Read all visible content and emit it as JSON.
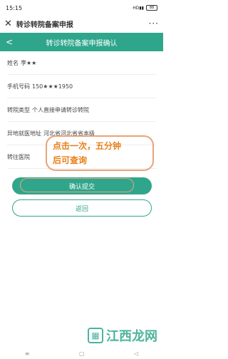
{
  "status_bar": {
    "time": "15:15",
    "signal": "HD▮▮",
    "battery": "88"
  },
  "app_header": {
    "close_symbol": "✕",
    "title": "转诊转院备案申报",
    "more_symbol": "···"
  },
  "page_header": {
    "back_symbol": "<",
    "title": "转诊转院备案申报确认"
  },
  "form": {
    "rows": [
      {
        "label": "姓名",
        "value": "李★★"
      },
      {
        "label": "手机号码",
        "value": "150★★★1950"
      },
      {
        "label": "转院类型",
        "value": "个人直接申请转诊转院"
      },
      {
        "label": "异地就医地址",
        "value": "河北省河北省省本级"
      },
      {
        "label": "转往医院",
        "value": ""
      }
    ]
  },
  "annotation": {
    "line1": "点击一次，五分钟",
    "line2": "后可查询"
  },
  "buttons": {
    "confirm_label": "确认提交",
    "back_label": "返回"
  },
  "watermark": {
    "text": "江西龙网"
  },
  "colors": {
    "accent": "#2fa68c",
    "annotation": "#e8801a"
  },
  "icons": {
    "close": "close-icon",
    "more": "more-icon",
    "back": "back-arrow-icon"
  }
}
